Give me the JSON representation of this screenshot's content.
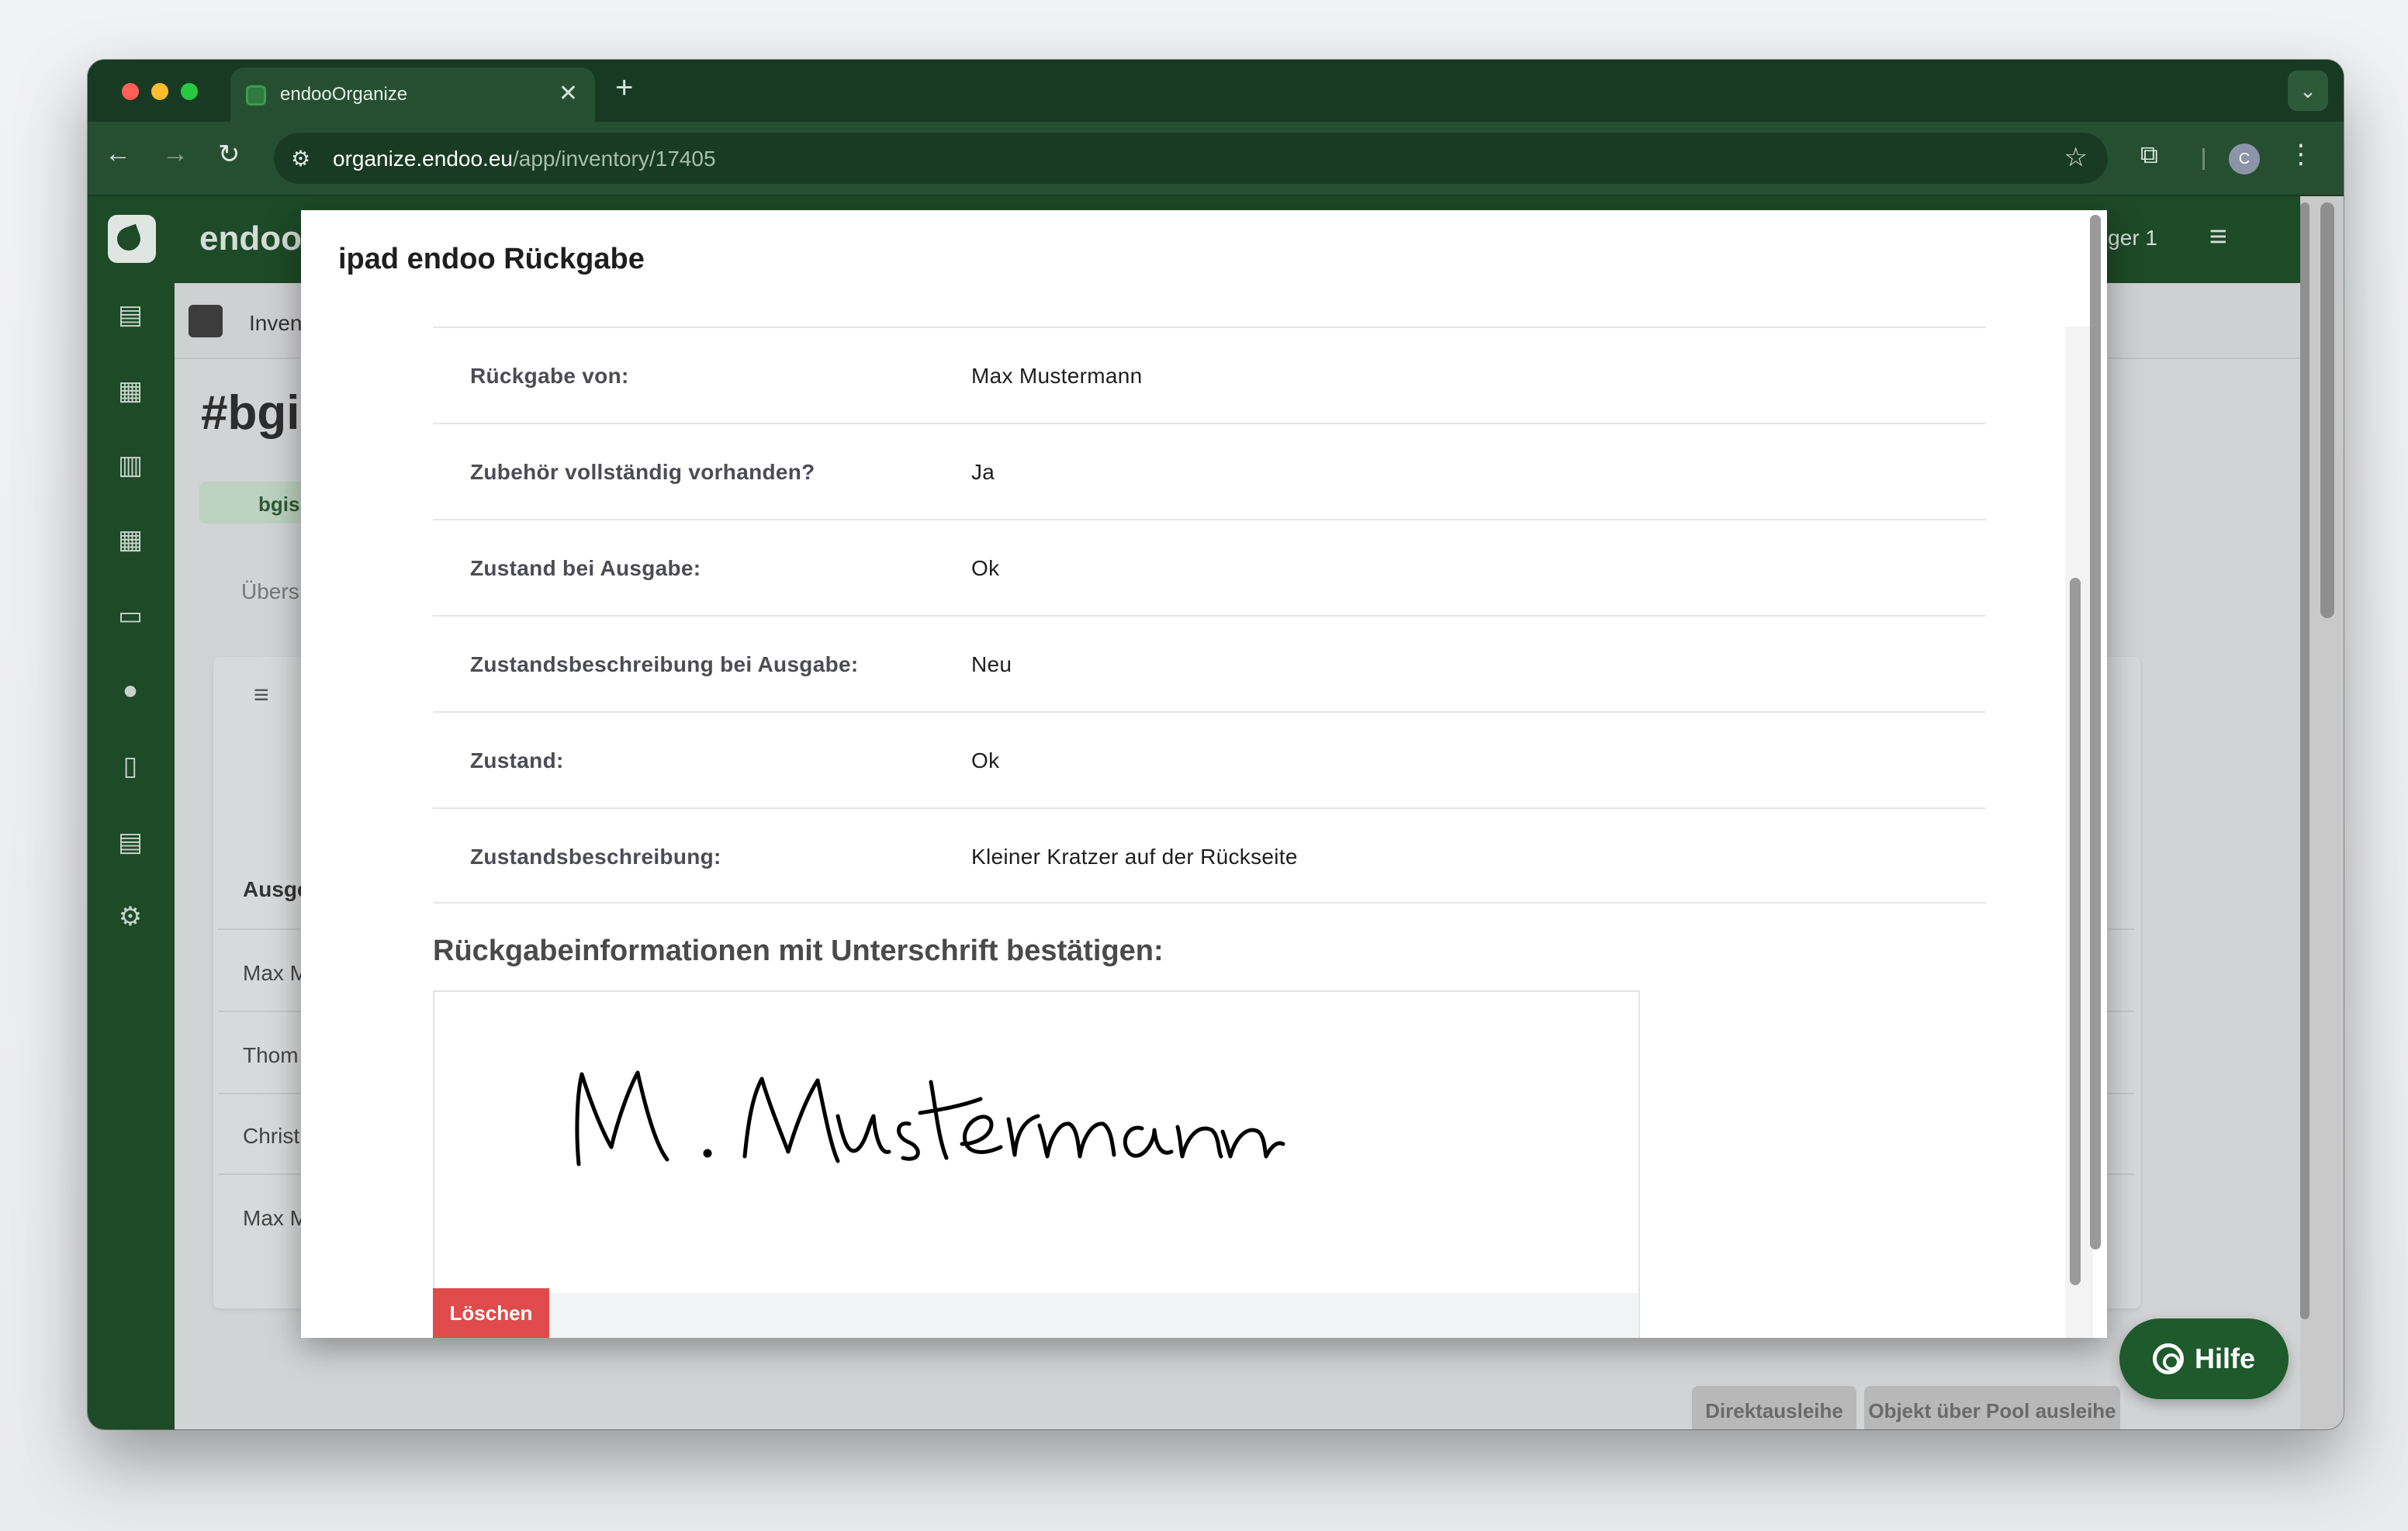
{
  "browser": {
    "tab_title": "endooOrganize",
    "tab_close": "✕",
    "new_tab": "+",
    "tab_menu": "⌄",
    "url_host": "organize.endoo.eu",
    "url_path": "/app/inventory/17405",
    "profile_initial": "C",
    "icons": {
      "back": "←",
      "forward": "→",
      "reload": "↻",
      "site_settings": "⚙",
      "bookmark": "☆",
      "extensions": "⧉",
      "menu": "⋮"
    }
  },
  "app": {
    "brand_partial": "endooO",
    "user_partial": "ger 1",
    "hamburger": "≡",
    "breadcrumb_partial": "Inven",
    "page_title_partial": "#bgis",
    "chip_partial": "bgis",
    "overview_partial": "Übers",
    "filter_icon": "≡",
    "table_header_partial": "Ausge",
    "rows_partial": [
      "Max M",
      "Thom",
      "Christ",
      "Max M"
    ],
    "buttons": {
      "direct_loan": "Direktausleihe",
      "pool_loan": "Objekt über Pool ausleihe"
    }
  },
  "modal": {
    "title": "ipad endoo Rückgabe",
    "rows": [
      {
        "label": "Rückgabe von:",
        "value": "Max Mustermann"
      },
      {
        "label": "Zubehör vollständig vorhanden?",
        "value": "Ja"
      },
      {
        "label": "Zustand bei Ausgabe:",
        "value": "Ok"
      },
      {
        "label": "Zustandsbeschreibung bei Ausgabe:",
        "value": "Neu"
      },
      {
        "label": "Zustand:",
        "value": "Ok"
      },
      {
        "label": "Zustandsbeschreibung:",
        "value": "Kleiner Kratzer auf der Rückseite"
      }
    ],
    "signature_heading": "Rückgabeinformationen mit Unterschrift bestätigen:",
    "signature_text": "M. Mustermann",
    "delete_button": "Löschen"
  },
  "help": {
    "label": "Hilfe"
  },
  "colors": {
    "brand_green": "#1d4a27",
    "danger_red": "#e04b4b",
    "help_green": "#1e5a2c"
  }
}
